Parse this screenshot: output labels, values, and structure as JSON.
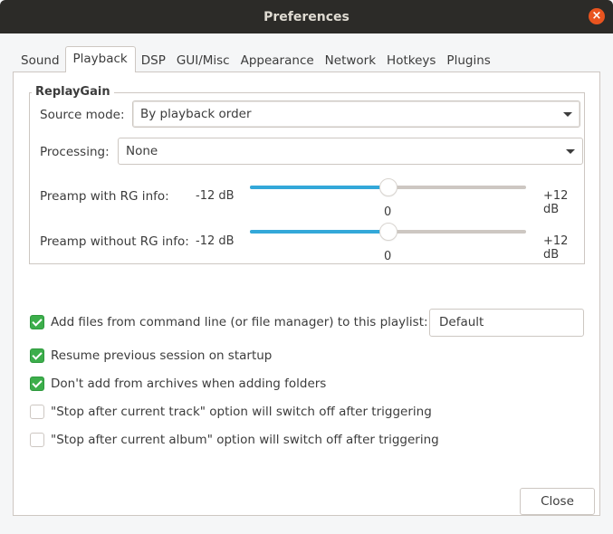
{
  "window": {
    "title": "Preferences",
    "close_icon": "close-icon"
  },
  "tabs": [
    {
      "label": "Sound",
      "active": false
    },
    {
      "label": "Playback",
      "active": true
    },
    {
      "label": "DSP",
      "active": false
    },
    {
      "label": "GUI/Misc",
      "active": false
    },
    {
      "label": "Appearance",
      "active": false
    },
    {
      "label": "Network",
      "active": false
    },
    {
      "label": "Hotkeys",
      "active": false
    },
    {
      "label": "Plugins",
      "active": false
    }
  ],
  "replaygain": {
    "legend": "ReplayGain",
    "source_mode": {
      "label": "Source mode:",
      "value": "By playback order"
    },
    "processing": {
      "label": "Processing:",
      "value": "None"
    },
    "preamp_with": {
      "label": "Preamp with RG info:",
      "min_label": "-12 dB",
      "max_label": "+12 dB",
      "value": "0",
      "min": -12,
      "max": 12,
      "current": 0
    },
    "preamp_without": {
      "label": "Preamp without RG info:",
      "min_label": "-12 dB",
      "max_label": "+12 dB",
      "value": "0",
      "min": -12,
      "max": 12,
      "current": 0
    }
  },
  "options": {
    "add_files": {
      "label": "Add files from command line (or file manager) to this playlist:",
      "checked": true,
      "playlist_value": "Default"
    },
    "resume_session": {
      "label": "Resume previous session on startup",
      "checked": true
    },
    "no_archives": {
      "label": "Don't add from archives when adding folders",
      "checked": true
    },
    "stop_track": {
      "label": "\"Stop after current track\" option will switch off after triggering",
      "checked": false
    },
    "stop_album": {
      "label": "\"Stop after current album\" option will switch off after triggering",
      "checked": false
    }
  },
  "footer": {
    "close_label": "Close"
  },
  "colors": {
    "accent": "#33a8d9",
    "check": "#3cae4b",
    "titlebar": "#2c2b28",
    "close_button": "#e9541f"
  }
}
